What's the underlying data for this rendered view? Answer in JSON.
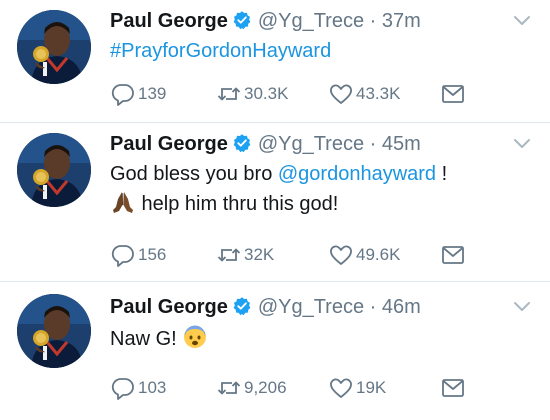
{
  "colors": {
    "link": "#1b95e0",
    "meta": "#657786",
    "text": "#14171a",
    "verified": "#1da1f2",
    "divider": "#e1e8ed"
  },
  "tweets": [
    {
      "name": "Paul George",
      "handle": "@Yg_Trece",
      "dot": "·",
      "time": "37m",
      "hashtag": "#PrayforGordonHayward",
      "replies": "139",
      "retweets": "30.3K",
      "likes": "43.3K"
    },
    {
      "name": "Paul George",
      "handle": "@Yg_Trece",
      "dot": "·",
      "time": "45m",
      "line1_prefix": "God bless you bro ",
      "mention": "@gordonhayward",
      "line1_suffix": " !",
      "line2": " help him thru this god!",
      "emoji": "folded-hands-emoji",
      "replies": "156",
      "retweets": "32K",
      "likes": "49.6K"
    },
    {
      "name": "Paul George",
      "handle": "@Yg_Trece",
      "dot": "·",
      "time": "46m",
      "text": "Naw G! ",
      "emoji": "fearful-face-emoji",
      "replies": "103",
      "retweets": "9,206",
      "likes": "19K"
    }
  ]
}
